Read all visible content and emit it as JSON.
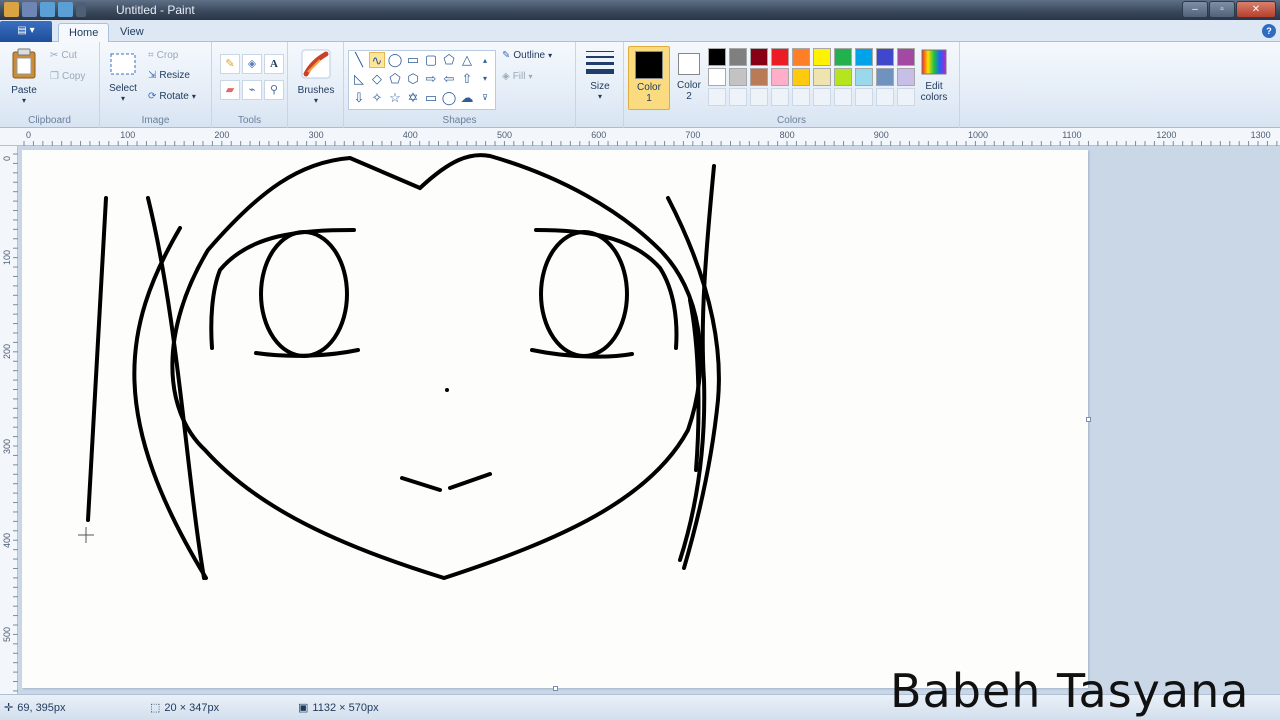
{
  "window": {
    "title": "Untitled - Paint"
  },
  "tabs": {
    "home": "Home",
    "view": "View"
  },
  "clipboard": {
    "paste": "Paste",
    "cut": "Cut",
    "copy": "Copy",
    "group": "Clipboard"
  },
  "image": {
    "select": "Select",
    "crop": "Crop",
    "resize": "Resize",
    "rotate": "Rotate",
    "group": "Image"
  },
  "tools": {
    "group": "Tools",
    "text_glyph": "A"
  },
  "brushes": {
    "label": "Brushes"
  },
  "shapes": {
    "group": "Shapes",
    "outline": "Outline",
    "fill": "Fill"
  },
  "size": {
    "label": "Size"
  },
  "colors": {
    "color1_line1": "Color",
    "color1_line2": "1",
    "color2_line1": "Color",
    "color2_line2": "2",
    "edit_line1": "Edit",
    "edit_line2": "colors",
    "group": "Colors",
    "color1": "#000000",
    "color2": "#ffffff",
    "palette_row1": [
      "#000000",
      "#7f7f7f",
      "#880015",
      "#ed1c24",
      "#ff7f27",
      "#fff200",
      "#22b14c",
      "#00a2e8",
      "#3f48cc",
      "#a349a4"
    ],
    "palette_row2": [
      "#ffffff",
      "#c3c3c3",
      "#b97a57",
      "#ffaec9",
      "#ffc90e",
      "#efe4b0",
      "#b5e61d",
      "#99d9ea",
      "#7092be",
      "#c8bfe7"
    ]
  },
  "ruler": {
    "h": [
      "0",
      "100",
      "200",
      "300",
      "400",
      "500",
      "600",
      "700",
      "800",
      "900",
      "1000",
      "1100",
      "1200",
      "1300"
    ],
    "v": [
      "0",
      "100",
      "200",
      "300",
      "400",
      "500"
    ]
  },
  "status": {
    "cursor": "69, 395px",
    "selection": "20 × 347px",
    "canvas_size": "1132 × 570px"
  },
  "watermark": "Babeh Tasyana"
}
